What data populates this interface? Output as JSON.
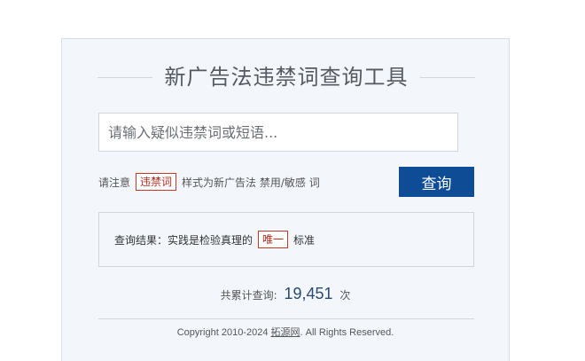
{
  "title": "新广告法违禁词查询工具",
  "search": {
    "placeholder": "请输入疑似违禁词或短语..."
  },
  "note": {
    "prefix": "请注意",
    "tag": "违禁词",
    "suffix": "样式为新广告法 禁用/敏感 词"
  },
  "query_button": "查询",
  "result": {
    "prefix": "查询结果：实践是检验真理的",
    "tag": "唯一",
    "suffix": "标准"
  },
  "counter": {
    "label": "共累计查询:",
    "value": "19,451",
    "unit": "次"
  },
  "footer": {
    "prefix": "Copyright 2010-2024",
    "link": "拓源网",
    "suffix": ". All Rights Reserved."
  },
  "colors": {
    "button": "#0f4c96",
    "tag_border": "#c0392b",
    "card_bg": "#f3f7fc"
  }
}
